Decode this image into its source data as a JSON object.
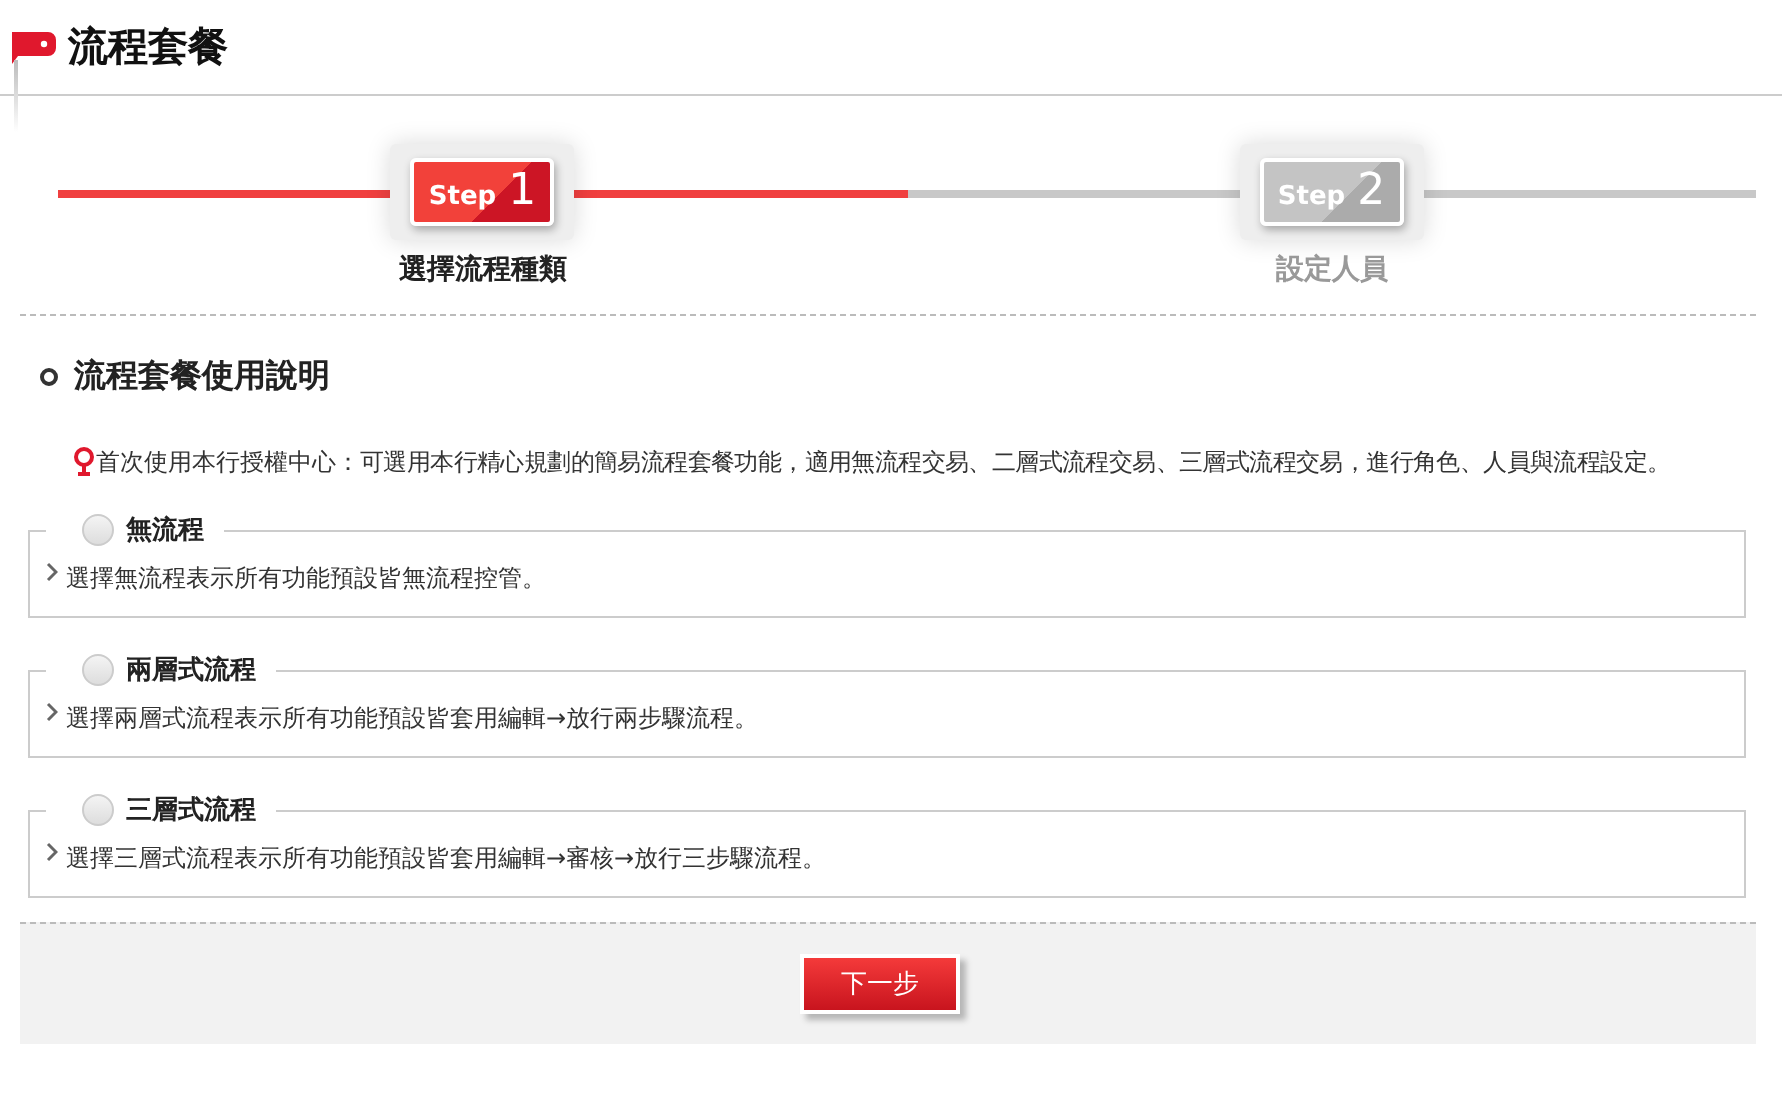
{
  "header": {
    "title": "流程套餐"
  },
  "progress": {
    "level": 0.5
  },
  "steps": [
    {
      "word": "Step",
      "number": "1",
      "label": "選擇流程種類",
      "selected": true
    },
    {
      "word": "Step",
      "number": "2",
      "label": "設定人員",
      "selected": false
    }
  ],
  "intro": {
    "title": "流程套餐使用說明",
    "hint_label": "首次使用本行授權中心：",
    "hint_text": "可選用本行精心規劃的簡易流程套餐功能，適用無流程交易、二層式流程交易、三層式流程交易，進行角色、人員與流程設定。"
  },
  "options": [
    {
      "label": "無流程",
      "description": "選擇無流程表示所有功能預設皆無流程控管。",
      "selected": false
    },
    {
      "label": "兩層式流程",
      "description": "選擇兩層式流程表示所有功能預設皆套用編輯→放行兩步驟流程。",
      "selected": false
    },
    {
      "label": "三層式流程",
      "description": "選擇三層式流程表示所有功能預設皆套用編輯→審核→放行三步驟流程。",
      "selected": false
    }
  ],
  "next_button": "下一步"
}
